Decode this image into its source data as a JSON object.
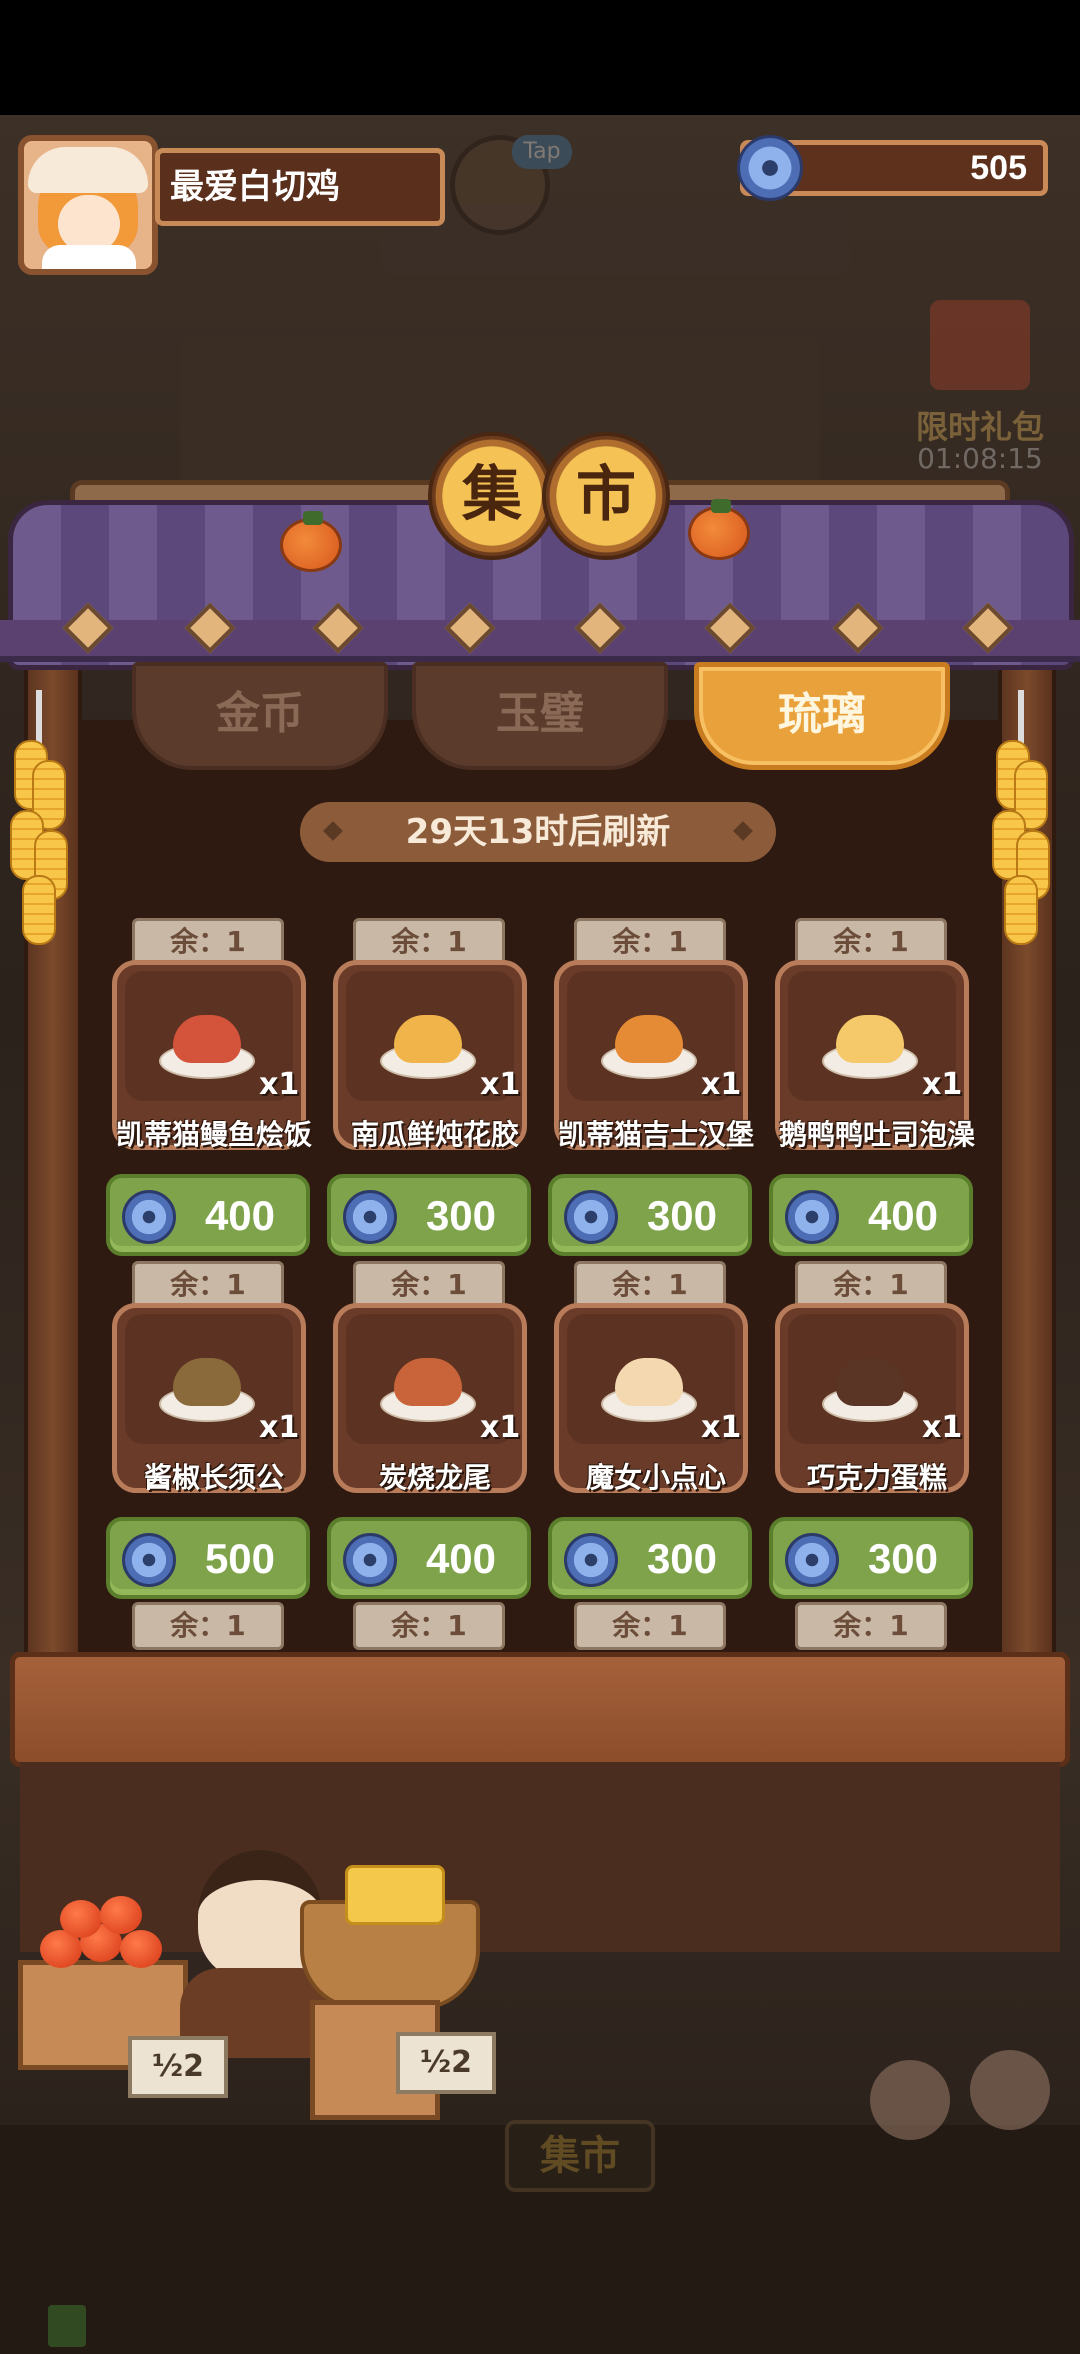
{
  "player": {
    "name": "最爱白切鸡"
  },
  "header": {
    "tap_label": "Tap",
    "currency": {
      "icon": "glass-bead-icon",
      "value": "505"
    }
  },
  "limited_gift": {
    "title": "限时礼包",
    "timer": "01:08:15"
  },
  "market": {
    "title_chars": [
      "集",
      "市"
    ],
    "tabs": [
      {
        "label": "金币",
        "active": false
      },
      {
        "label": "玉璧",
        "active": false
      },
      {
        "label": "琉璃",
        "active": true
      }
    ],
    "refresh_text": "29天13时后刷新",
    "currency_icon": "glass-bead-icon",
    "items": [
      {
        "stock": "余：1",
        "name": "凯蒂猫鳗鱼烩饭",
        "qty": "x1",
        "price": "400",
        "color": "#d3543a"
      },
      {
        "stock": "余：1",
        "name": "南瓜鲜炖花胶",
        "qty": "x1",
        "price": "300",
        "color": "#f0b44a"
      },
      {
        "stock": "余：1",
        "name": "凯蒂猫吉士汉堡",
        "qty": "x1",
        "price": "300",
        "color": "#e58a35"
      },
      {
        "stock": "余：1",
        "name": "鹅鸭鸭吐司泡澡",
        "qty": "x1",
        "price": "400",
        "color": "#f5c96a"
      },
      {
        "stock": "余：1",
        "name": "酱椒长须公",
        "qty": "x1",
        "price": "500",
        "color": "#8a6a3a"
      },
      {
        "stock": "余：1",
        "name": "炭烧龙尾",
        "qty": "x1",
        "price": "400",
        "color": "#c9643a"
      },
      {
        "stock": "余：1",
        "name": "魔女小点心",
        "qty": "x1",
        "price": "300",
        "color": "#f4d8b0"
      },
      {
        "stock": "余：1",
        "name": "巧克力蛋糕",
        "qty": "x1",
        "price": "300",
        "color": "#5a3424"
      }
    ],
    "next_row_stock": [
      "余：1",
      "余：1",
      "余：1",
      "余：1"
    ]
  },
  "stall_signs": [
    "½2",
    "½2"
  ],
  "bottom_button": "集市"
}
